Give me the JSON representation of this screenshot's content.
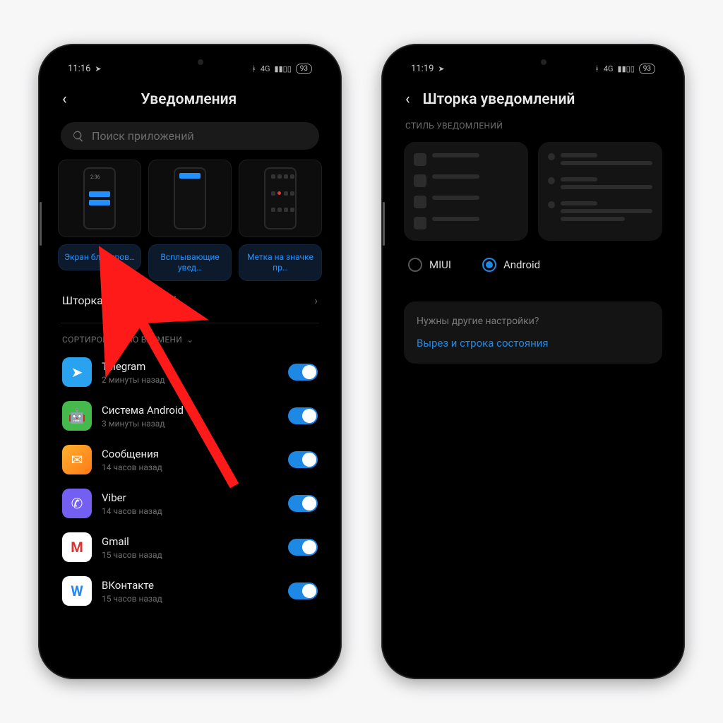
{
  "phone1": {
    "status": {
      "time": "11:16",
      "battery": "93"
    },
    "title": "Уведомления",
    "search_placeholder": "Поиск приложений",
    "cards": {
      "lock": "Экран блокиров…",
      "float": "Всплывающие увед…",
      "badge": "Метка на значке пр…",
      "mini_clock": "2:36"
    },
    "shade_row": "Шторка уведомлений",
    "sort_label": "СОРТИРОВАТЬ ПО ВРЕМЕНИ",
    "apps": [
      {
        "name": "Telegram",
        "sub": "2 минуты назад",
        "icon": "tg",
        "glyph": "➤"
      },
      {
        "name": "Система Android",
        "sub": "3 минуты назад",
        "icon": "sys",
        "glyph": "🤖"
      },
      {
        "name": "Сообщения",
        "sub": "14 часов назад",
        "icon": "msg",
        "glyph": "✉"
      },
      {
        "name": "Viber",
        "sub": "14 часов назад",
        "icon": "vib",
        "glyph": "✆"
      },
      {
        "name": "Gmail",
        "sub": "15 часов назад",
        "icon": "gm",
        "glyph": "M"
      },
      {
        "name": "ВКонтакте",
        "sub": "15 часов назад",
        "icon": "vk",
        "glyph": "W"
      }
    ]
  },
  "phone2": {
    "status": {
      "time": "11:19",
      "battery": "93"
    },
    "title": "Шторка уведомлений",
    "style_label": "СТИЛЬ УВЕДОМЛЕНИЙ",
    "radios": {
      "miui": "MIUI",
      "android": "Android",
      "selected": "android"
    },
    "more": {
      "question": "Нужны другие настройки?",
      "link": "Вырез и строка состояния"
    }
  }
}
